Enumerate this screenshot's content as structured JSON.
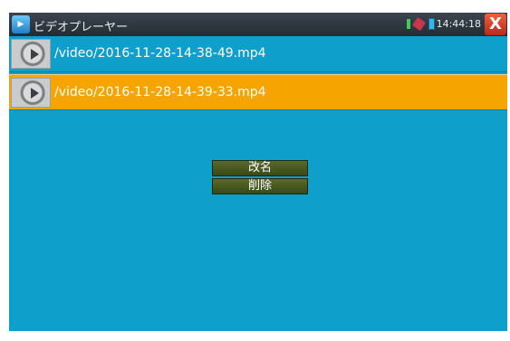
{
  "app": {
    "title": "ビデオプレーヤー",
    "icon": "video-app-icon"
  },
  "status": {
    "clock": "14:44:18",
    "close_label": "X",
    "indicators": [
      "signal-indicator-icon",
      "usb-plug-icon",
      "battery-icon"
    ]
  },
  "files": [
    {
      "name": "/video/2016-11-28-14-38-49.mp4",
      "selected": false
    },
    {
      "name": "/video/2016-11-28-14-39-33.mp4",
      "selected": true
    }
  ],
  "context_menu": {
    "items": [
      {
        "label": "改名"
      },
      {
        "label": "削除"
      }
    ]
  },
  "colors": {
    "screen_bg": "#0f9fcb",
    "selected_row": "#f6a400",
    "menu_button": "#4a5820",
    "titlebar": "#2f3840"
  }
}
